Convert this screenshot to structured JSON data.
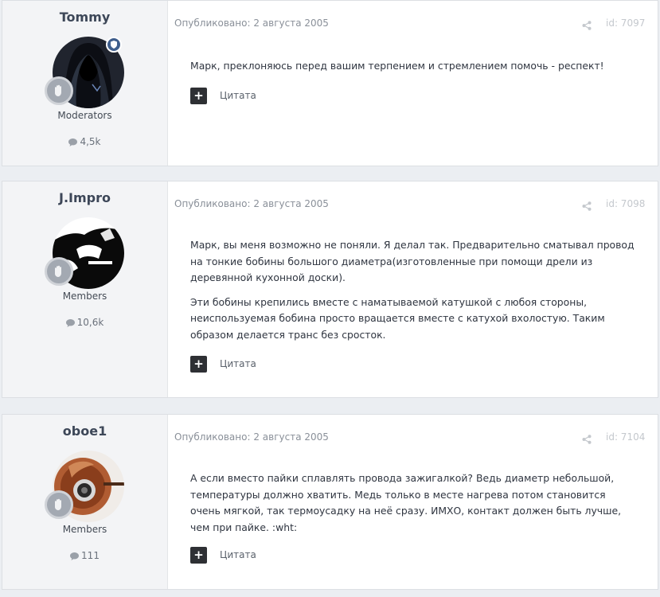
{
  "posts": [
    {
      "author": "Tommy",
      "group": "Moderators",
      "post_count": "4,5k",
      "published": "Опубликовано: 2 августа 2005",
      "id_label": "id: 7097",
      "paragraphs": [
        "Марк, преклоняюсь перед вашим терпением и стремлением помочь - респект!"
      ],
      "quote_icon": "+",
      "quote_label": "Цитата"
    },
    {
      "author": "J.Impro",
      "group": "Members",
      "post_count": "10,6k",
      "published": "Опубликовано: 2 августа 2005",
      "id_label": "id: 7098",
      "paragraphs": [
        "Марк, вы меня возможно не поняли. Я делал так. Предварительно сматывал провод на тонкие бобины большого диаметра(изготовленные при помощи дрели из деревянной кухонной доски).",
        "Эти бобины крепились вместе с наматываемой катушкой с любоя стороны, неиспользуемая бобина просто вращается вместе с катухой вхолостую. Таким образом делается транс без сросток."
      ],
      "quote_icon": "+",
      "quote_label": "Цитата"
    },
    {
      "author": "oboe1",
      "group": "Members",
      "post_count": "111",
      "published": "Опубликовано: 2 августа 2005",
      "id_label": "id: 7104",
      "paragraphs": [
        "А если вместо пайки сплавлять провода зажигалкой? Ведь диаметр небольшой, температуры должно хватить. Медь только в месте нагрева потом становится очень мягкой, так термоусадку на неё сразу. ИМХО, контакт должен быть лучше, чем при пайке. :wht:"
      ],
      "quote_icon": "+",
      "quote_label": "Цитата"
    }
  ],
  "icons": {
    "share": "share-icon",
    "comment": "comment-bubble-icon",
    "rank": "hand-badge-icon",
    "moderator": "shield-icon"
  },
  "colors": {
    "background": "#ebeef2",
    "author_panel": "#f3f4f6",
    "moderator_badge": "#3f5e8c",
    "quote_button": "#2e3034"
  }
}
